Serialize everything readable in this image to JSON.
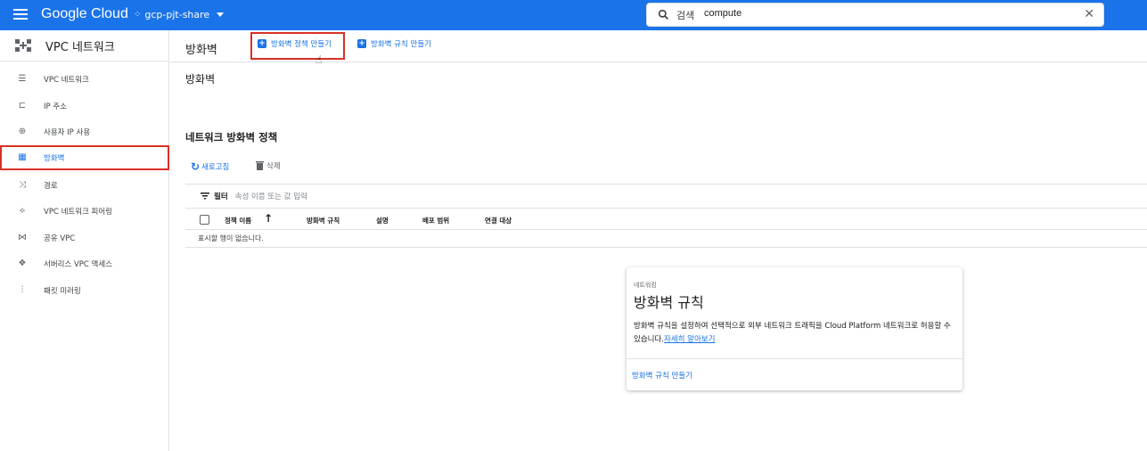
{
  "topbar": {
    "brand": "Google Cloud",
    "project": "gcp-pjt-share",
    "search_label": "검색",
    "search_value": "compute",
    "close_glyph": "✕"
  },
  "sidebar": {
    "title": "VPC 네트워크",
    "items": [
      {
        "label": "VPC 네트워크",
        "icon": "network-icon"
      },
      {
        "label": "IP 주소",
        "icon": "ip-address-icon"
      },
      {
        "label": "사용자 IP 사용",
        "icon": "globe-icon"
      },
      {
        "label": "방화벽",
        "icon": "firewall-icon"
      },
      {
        "label": "경로",
        "icon": "route-icon"
      },
      {
        "label": "VPC 네트워크 피어링",
        "icon": "peering-icon"
      },
      {
        "label": "공유 VPC",
        "icon": "shared-vpc-icon"
      },
      {
        "label": "서버리스 VPC 액세스",
        "icon": "serverless-icon"
      },
      {
        "label": "패킷 미러링",
        "icon": "packet-mirroring-icon"
      }
    ]
  },
  "action_bar": {
    "title": "방화벽",
    "create_policy": "방화벽 정책 만들기",
    "create_rule": "방화벽 규칙 만들기"
  },
  "main": {
    "subtitle": "방화벽",
    "section_title": "네트워크 방화벽 정책",
    "refresh": "새로고침",
    "delete": "삭제",
    "filter_label": "필터",
    "filter_placeholder": "속성 이름 또는 값 입력",
    "columns": [
      "정책 이름",
      "방화벽 규칙",
      "설명",
      "배포 범위",
      "연결 대상"
    ],
    "empty_text": "표시할 행이 없습니다."
  },
  "card": {
    "eyebrow": "네트워킹",
    "title": "방화벽 규칙",
    "description": "방화벽 규칙을 설정하여 선택적으로 외부 네트워크 트래픽을 Cloud Platform 네트워크로 허용할 수 있습니다.",
    "learn_more": "자세히 알아보기",
    "action": "방화벽 규칙 만들기"
  },
  "colors": {
    "primary": "#1a73e8",
    "highlight": "#d93025"
  }
}
